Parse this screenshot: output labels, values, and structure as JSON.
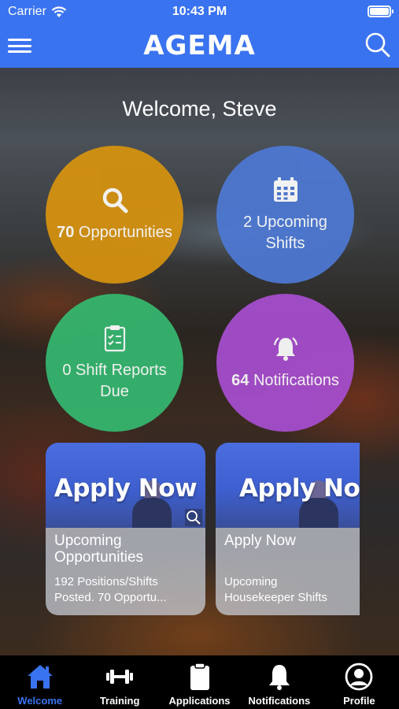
{
  "status_bar": {
    "carrier": "Carrier",
    "time": "10:43 PM",
    "battery_level": 1.0
  },
  "header": {
    "logo": "AGEMA",
    "menu_icon": "hamburger-menu-icon",
    "search_icon": "search-icon"
  },
  "welcome": "Welcome, Steve",
  "tiles": {
    "opportunities": {
      "count": "70",
      "label": "Opportunities",
      "icon": "search-icon",
      "color": "#d7930f"
    },
    "shifts": {
      "text": "2 Upcoming Shifts",
      "icon": "calendar-icon",
      "color": "#4d79d4"
    },
    "reports": {
      "text": "0 Shift Reports Due",
      "icon": "clipboard-check-icon",
      "color": "#35b870"
    },
    "notifications": {
      "count": "64",
      "label": "Notifications",
      "icon": "bell-ringing-icon",
      "color": "#a74ed0"
    }
  },
  "cards": [
    {
      "banner": "Apply Now",
      "title": "Upcoming Opportunities",
      "desc_line1": "192 Positions/Shifts",
      "desc_line2": "Posted. 70 Opportu..."
    },
    {
      "banner": "Apply Now",
      "title": "Apply Now",
      "desc_line1": "Upcoming",
      "desc_line2": "Housekeeper Shifts"
    }
  ],
  "tabs": [
    {
      "label": "Welcome",
      "icon": "home-icon",
      "active": true
    },
    {
      "label": "Training",
      "icon": "dumbbell-icon"
    },
    {
      "label": "Applications",
      "icon": "clipboard-icon"
    },
    {
      "label": "Notifications",
      "icon": "bell-icon"
    },
    {
      "label": "Profile",
      "icon": "user-circle-icon"
    }
  ],
  "colors": {
    "accent": "#3a73f0",
    "tabbar": "#000000"
  }
}
